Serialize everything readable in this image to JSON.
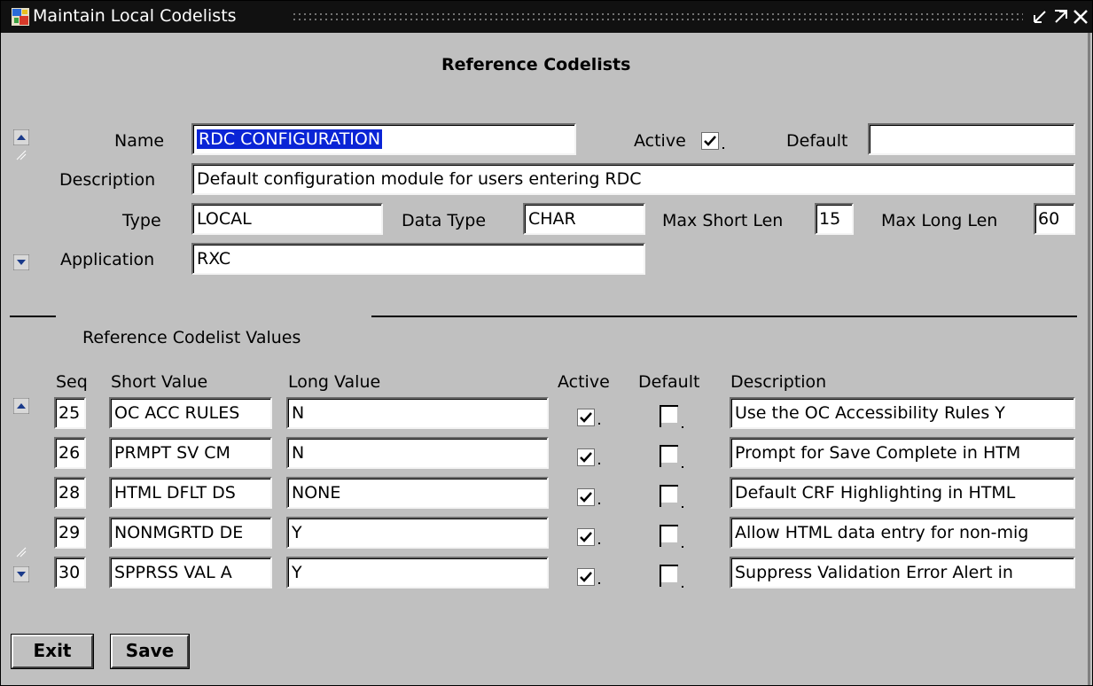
{
  "window": {
    "title": "Maintain Local Codelists"
  },
  "page_title": "Reference Codelists",
  "header": {
    "name_label": "Name",
    "name_value": "RDC CONFIGURATION",
    "active_label": "Active",
    "active_checked": true,
    "default_label": "Default",
    "default_value": "",
    "description_label": "Description",
    "description_value": "Default configuration module for users entering RDC",
    "type_label": "Type",
    "type_value": "LOCAL",
    "data_type_label": "Data Type",
    "data_type_value": "CHAR",
    "max_short_len_label": "Max Short Len",
    "max_short_len_value": "15",
    "max_long_len_label": "Max Long Len",
    "max_long_len_value": "60",
    "application_label": "Application",
    "application_value": "RXC"
  },
  "values_section": {
    "title": "Reference Codelist Values",
    "columns": {
      "seq": "Seq",
      "short_value": "Short Value",
      "long_value": "Long Value",
      "active": "Active",
      "default": "Default",
      "description": "Description"
    },
    "rows": [
      {
        "seq": "25",
        "short_value": "OC ACC RULES",
        "long_value": "N",
        "active": true,
        "default": false,
        "description": "Use the OC Accessibility Rules Y"
      },
      {
        "seq": "26",
        "short_value": "PRMPT SV CM",
        "long_value": "N",
        "active": true,
        "default": false,
        "description": "Prompt for Save Complete in HTM"
      },
      {
        "seq": "28",
        "short_value": "HTML DFLT DS",
        "long_value": "NONE",
        "active": true,
        "default": false,
        "description": "Default CRF Highlighting in HTML"
      },
      {
        "seq": "29",
        "short_value": "NONMGRTD DE",
        "long_value": "Y",
        "active": true,
        "default": false,
        "description": "Allow HTML data entry for non-mig"
      },
      {
        "seq": "30",
        "short_value": "SPPRSS VAL A",
        "long_value": "Y",
        "active": true,
        "default": false,
        "description": "Suppress Validation Error Alert in"
      }
    ]
  },
  "buttons": {
    "exit": "Exit",
    "save": "Save"
  },
  "icons": {
    "app": "app-icon",
    "minimize": "minimize-icon",
    "maximize": "maximize-icon",
    "close": "close-icon",
    "scroll_up": "scroll-up-icon",
    "scroll_down": "scroll-down-icon",
    "checkmark": "checkmark-icon"
  },
  "colors": {
    "background": "#c0c0c0",
    "titlebar": "#111111",
    "selection": "#0a24d6"
  }
}
